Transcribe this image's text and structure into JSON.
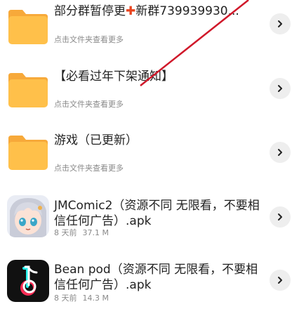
{
  "items": [
    {
      "type": "folder",
      "title_a": "部分群暂停更",
      "title_plus": "✚",
      "title_b": "新群739939930...",
      "subtitle": "点击文件夹查看更多",
      "chevron_icon": "chevron-right-icon"
    },
    {
      "type": "folder",
      "title": "【必看过年下架通知】",
      "subtitle": "点击文件夹查看更多",
      "chevron_icon": "chevron-right-icon"
    },
    {
      "type": "folder",
      "title": "游戏（已更新）",
      "subtitle": "点击文件夹查看更多",
      "chevron_icon": "chevron-right-icon"
    },
    {
      "type": "file",
      "title": "JMComic2（资源不同 无限看，不要相信任何广告）.apk",
      "time": "8 天前",
      "size": "37.1 M",
      "icon": "anime-girl-app-icon",
      "chevron_icon": "chevron-right-icon"
    },
    {
      "type": "file",
      "title": "Bean pod（资源不同 无限看，不要相信任何广告）.apk",
      "time": "8 天前",
      "size": "14.3 M",
      "icon": "bean-pod-app-icon",
      "chevron_icon": "chevron-right-icon"
    }
  ],
  "colors": {
    "folder": "#ffc04a",
    "folder_tab": "#f7a93a",
    "plus": "#e8441f",
    "annotation_line": "#d0182a",
    "chevron_bg": "#eeeeee"
  }
}
